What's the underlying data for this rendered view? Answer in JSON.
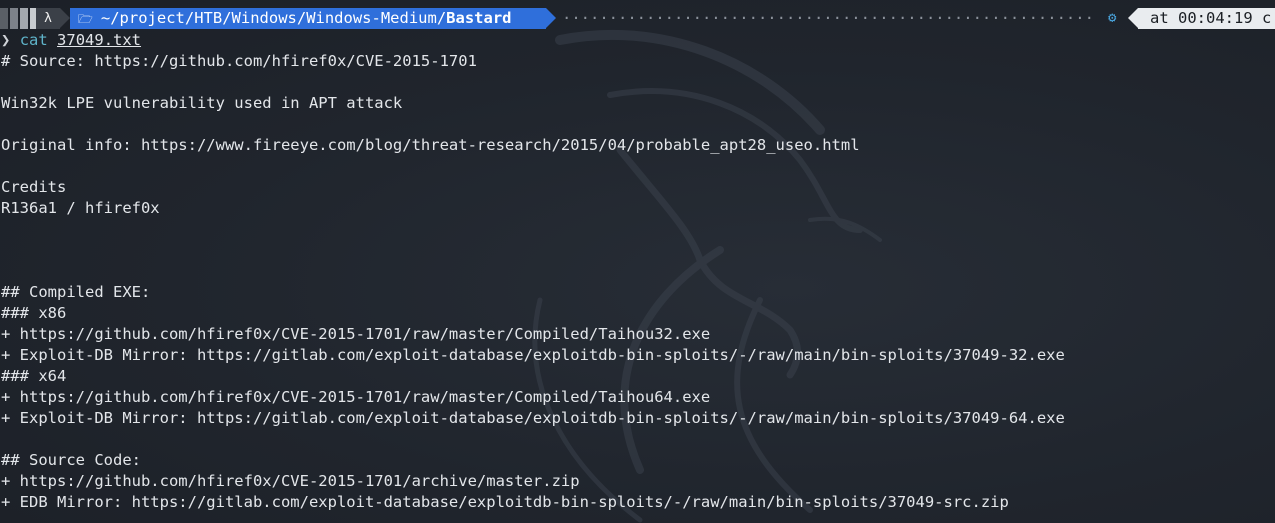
{
  "prompt": {
    "os_icon": "linux-icon",
    "os_glyph": "λ",
    "folder_icon": "folder-icon",
    "path_prefix": "~/project/HTB/Windows/Windows-Medium/",
    "path_current": "Bastard",
    "filler_dots": "·································································",
    "gear_icon": "gear-icon",
    "time_label": "at 00:04:19 c"
  },
  "command": {
    "prompt_symbol": "❯",
    "name": "cat",
    "argument": "37049.txt"
  },
  "output_lines": [
    "# Source: https://github.com/hfiref0x/CVE-2015-1701",
    "",
    "Win32k LPE vulnerability used in APT attack",
    "",
    "Original info: https://www.fireeye.com/blog/threat-research/2015/04/probable_apt28_useo.html",
    "",
    "Credits",
    "R136a1 / hfiref0x",
    "",
    "",
    "",
    "## Compiled EXE:",
    "### x86",
    "+ https://github.com/hfiref0x/CVE-2015-1701/raw/master/Compiled/Taihou32.exe",
    "+ Exploit-DB Mirror: https://gitlab.com/exploit-database/exploitdb-bin-sploits/-/raw/main/bin-sploits/37049-32.exe",
    "### x64",
    "+ https://github.com/hfiref0x/CVE-2015-1701/raw/master/Compiled/Taihou64.exe",
    "+ Exploit-DB Mirror: https://gitlab.com/exploit-database/exploitdb-bin-sploits/-/raw/main/bin-sploits/37049-64.exe",
    "",
    "## Source Code:",
    "+ https://github.com/hfiref0x/CVE-2015-1701/archive/master.zip",
    "+ EDB Mirror: https://gitlab.com/exploit-database/exploitdb-bin-sploits/-/raw/main/bin-sploits/37049-src.zip"
  ],
  "colors": {
    "background": "#20252d",
    "path_segment": "#2f6fdb",
    "time_segment": "#e9ecef",
    "command_name": "#5fb3c9",
    "gear": "#4aa7e0"
  }
}
